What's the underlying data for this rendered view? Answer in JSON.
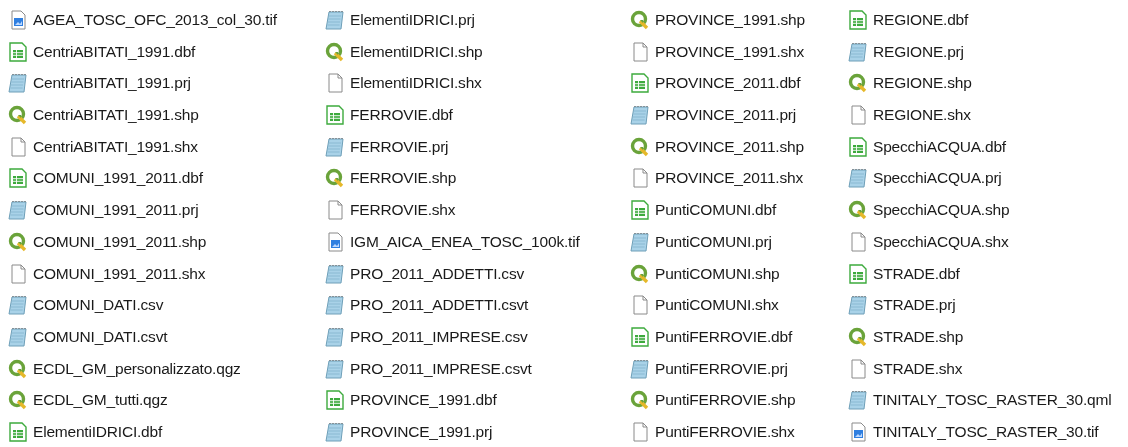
{
  "files": [
    {
      "name": "AGEA_TOSC_OFC_2013_col_30.tif",
      "kind": "image"
    },
    {
      "name": "CentriABITATI_1991.dbf",
      "kind": "sheet"
    },
    {
      "name": "CentriABITATI_1991.prj",
      "kind": "notepad"
    },
    {
      "name": "CentriABITATI_1991.shp",
      "kind": "qgis"
    },
    {
      "name": "CentriABITATI_1991.shx",
      "kind": "blank"
    },
    {
      "name": "COMUNI_1991_2011.dbf",
      "kind": "sheet"
    },
    {
      "name": "COMUNI_1991_2011.prj",
      "kind": "notepad"
    },
    {
      "name": "COMUNI_1991_2011.shp",
      "kind": "qgis"
    },
    {
      "name": "COMUNI_1991_2011.shx",
      "kind": "blank"
    },
    {
      "name": "COMUNI_DATI.csv",
      "kind": "notepad"
    },
    {
      "name": "COMUNI_DATI.csvt",
      "kind": "notepad"
    },
    {
      "name": "ECDL_GM_personalizzato.qgz",
      "kind": "qgis"
    },
    {
      "name": "ECDL_GM_tutti.qgz",
      "kind": "qgis"
    },
    {
      "name": "ElementiIDRICI.dbf",
      "kind": "sheet"
    },
    {
      "name": "ElementiIDRICI.prj",
      "kind": "notepad"
    },
    {
      "name": "ElementiIDRICI.shp",
      "kind": "qgis"
    },
    {
      "name": "ElementiIDRICI.shx",
      "kind": "blank"
    },
    {
      "name": "FERROVIE.dbf",
      "kind": "sheet"
    },
    {
      "name": "FERROVIE.prj",
      "kind": "notepad"
    },
    {
      "name": "FERROVIE.shp",
      "kind": "qgis"
    },
    {
      "name": "FERROVIE.shx",
      "kind": "blank"
    },
    {
      "name": "IGM_AICA_ENEA_TOSC_100k.tif",
      "kind": "image"
    },
    {
      "name": "PRO_2011_ADDETTI.csv",
      "kind": "notepad"
    },
    {
      "name": "PRO_2011_ADDETTI.csvt",
      "kind": "notepad"
    },
    {
      "name": "PRO_2011_IMPRESE.csv",
      "kind": "notepad"
    },
    {
      "name": "PRO_2011_IMPRESE.csvt",
      "kind": "notepad"
    },
    {
      "name": "PROVINCE_1991.dbf",
      "kind": "sheet"
    },
    {
      "name": "PROVINCE_1991.prj",
      "kind": "notepad"
    },
    {
      "name": "PROVINCE_1991.shp",
      "kind": "qgis"
    },
    {
      "name": "PROVINCE_1991.shx",
      "kind": "blank"
    },
    {
      "name": "PROVINCE_2011.dbf",
      "kind": "sheet"
    },
    {
      "name": "PROVINCE_2011.prj",
      "kind": "notepad"
    },
    {
      "name": "PROVINCE_2011.shp",
      "kind": "qgis"
    },
    {
      "name": "PROVINCE_2011.shx",
      "kind": "blank"
    },
    {
      "name": "PuntiCOMUNI.dbf",
      "kind": "sheet"
    },
    {
      "name": "PuntiCOMUNI.prj",
      "kind": "notepad"
    },
    {
      "name": "PuntiCOMUNI.shp",
      "kind": "qgis"
    },
    {
      "name": "PuntiCOMUNI.shx",
      "kind": "blank"
    },
    {
      "name": "PuntiFERROVIE.dbf",
      "kind": "sheet"
    },
    {
      "name": "PuntiFERROVIE.prj",
      "kind": "notepad"
    },
    {
      "name": "PuntiFERROVIE.shp",
      "kind": "qgis"
    },
    {
      "name": "PuntiFERROVIE.shx",
      "kind": "blank"
    },
    {
      "name": "REGIONE.dbf",
      "kind": "sheet"
    },
    {
      "name": "REGIONE.prj",
      "kind": "notepad"
    },
    {
      "name": "REGIONE.shp",
      "kind": "qgis"
    },
    {
      "name": "REGIONE.shx",
      "kind": "blank"
    },
    {
      "name": "SpecchiACQUA.dbf",
      "kind": "sheet"
    },
    {
      "name": "SpecchiACQUA.prj",
      "kind": "notepad"
    },
    {
      "name": "SpecchiACQUA.shp",
      "kind": "qgis"
    },
    {
      "name": "SpecchiACQUA.shx",
      "kind": "blank"
    },
    {
      "name": "STRADE.dbf",
      "kind": "sheet"
    },
    {
      "name": "STRADE.prj",
      "kind": "notepad"
    },
    {
      "name": "STRADE.shp",
      "kind": "qgis"
    },
    {
      "name": "STRADE.shx",
      "kind": "blank"
    },
    {
      "name": "TINITALY_TOSC_RASTER_30.qml",
      "kind": "notepad"
    },
    {
      "name": "TINITALY_TOSC_RASTER_30.tif",
      "kind": "image"
    }
  ]
}
